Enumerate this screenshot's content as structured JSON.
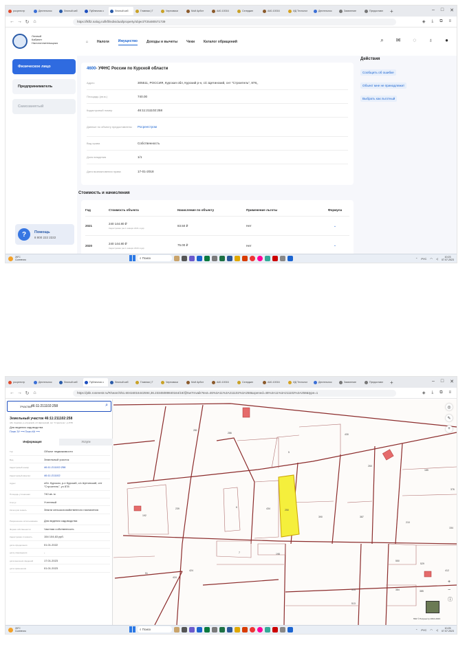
{
  "browser": {
    "tabs": [
      "росреестр",
      "Деятельнос",
      "Личный каб",
      "Публичная к",
      "Личный каб",
      "Главная | Г",
      "Черновики",
      "Мой Арбит",
      "А40-10016",
      "Селедкин",
      "А40-10016",
      "ИД Технолог",
      "Деятельнос",
      "Заявление",
      "Предоставл"
    ],
    "url1": "https://lkfl2.nalog.ru/lkfl/individual/property/object/T25480571739",
    "url2": "https://pkk.rosreestr.ru/#/search/51.60416016442594,36.23345089840164/19/@5w7rnvaik?text=46%3A11%3A211102%3A258&opened=46%3A11%3A211102%3A258&type=1"
  },
  "nalog": {
    "logo_text": [
      "Личный",
      "Кабинет",
      "Налогоплательщика"
    ],
    "sidebar": [
      "Физическое лицо",
      "Предприниматель",
      "Самозанятый"
    ],
    "help_title": "Помощь",
    "help_phone": "8 800 222 2222",
    "nav": [
      "Налоги",
      "Имущество",
      "Доходы и вычеты",
      "Чеки",
      "Каталог обращений"
    ],
    "card_title_code": "4600",
    "card_title": "- УФНС России по Курской области",
    "props": [
      {
        "label": "Адрес",
        "value": "305511, РОССИЯ, Курская обл, Курский р-н, с/с Щетинский, снт \"Строитель\", 878,,",
        "link": false
      },
      {
        "label": "Площадь (кв.м.)",
        "value": "740.00",
        "link": false
      },
      {
        "label": "Кадастровый номер",
        "value": "46:11:211102:258",
        "link": false
      },
      {
        "label": "Данные по объекту предоставлены",
        "value": "Росреестром",
        "link": true
      },
      {
        "label": "Вид права",
        "value": "Собственность",
        "link": false
      },
      {
        "label": "Доля владения",
        "value": "1/1",
        "link": false
      },
      {
        "label": "Дата возникновения права",
        "value": "17-01-2018",
        "link": false
      }
    ],
    "actions_title": "Действия",
    "actions": [
      "Сообщить об ошибке",
      "Объект мне не принадлежит",
      "Выбрать как льготный"
    ],
    "section": "Стоимость и начисления",
    "table_head": [
      "Год",
      "Стоимость объекта",
      "Начисление по объекту",
      "Применение льготы",
      "Формула"
    ],
    "rows": [
      {
        "year": "2021",
        "cost": "240 144.80 ₽",
        "cost_note": "Кадастровая (на 1 января 2021 года)",
        "charge": "83.50 ₽",
        "benefit": "Нет"
      },
      {
        "year": "2020",
        "cost": "240 144.80 ₽",
        "cost_note": "Кадастровая (на 1 января 2020 года)",
        "charge": "75.00 ₽",
        "benefit": "Нет"
      }
    ]
  },
  "rosreestr": {
    "search_label": "Участки",
    "search_value": "46:11:211102:258",
    "title": "Земельный участок 46:11:211102:258",
    "address_small": "обл. Курская, р-н Курский, с/с Щетинский, снт \"Строитель\", уч 878",
    "purpose": "Для ведения садоводства",
    "links": "План ЗУ ⟶     План КК ⟶",
    "tabs": [
      "Информация",
      "Услуги"
    ],
    "rows": [
      {
        "label": "Тип",
        "value": "Объект недвижимости"
      },
      {
        "label": "Вид",
        "value": "Земельный участок"
      },
      {
        "label": "Кадастровый номер",
        "value": "46:11:211102:258",
        "link": true
      },
      {
        "label": "Кадастровый квартал",
        "value": "46:11:211102",
        "link": true
      },
      {
        "label": "Адрес",
        "value": "обл. Курская, р-н Курский, с/с Щетинский, снт \"Строитель\", уч 878"
      },
      {
        "label": "Площадь уточненная",
        "value": "740 кв. м"
      },
      {
        "label": "Статус",
        "value": "Учтенный"
      },
      {
        "label": "Категория земель",
        "value": "Земли сельскохозяйственного назначения"
      },
      {
        "label": "Разрешенное использование",
        "value": "Для ведения садоводства"
      },
      {
        "label": "Форма собственности",
        "value": "Частная собственность"
      },
      {
        "label": "Кадастровая стоимость",
        "value": "154 104,63 руб."
      },
      {
        "label": "дата определения",
        "value": "01.01.2022"
      },
      {
        "label": "дата утверждения",
        "value": "-"
      },
      {
        "label": "дата внесения сведений",
        "value": "17.01.2023"
      },
      {
        "label": "дата применения",
        "value": "01.01.2023"
      }
    ],
    "parcels": [
      "281",
      "286",
      "430",
      "5",
      "260",
      "434",
      "239",
      "6",
      "424",
      "250",
      "390",
      "387",
      "210",
      "7",
      "198",
      "51",
      "424",
      "550",
      "529",
      "384",
      "385",
      "514",
      "513",
      "412",
      "154",
      "192",
      "376",
      "185"
    ],
    "copyright": "ПКК © Росреестр 2010-2023"
  },
  "taskbar": {
    "weather": "26°C",
    "weather_desc": "Солнечно",
    "search": "Поиск",
    "lang": "РУС",
    "time": "10:23",
    "date": "07.07.2023"
  },
  "taskbar2": {
    "time": "10:25",
    "date": "07.07.2023"
  },
  "colors": {
    "accent": "#1b64d0",
    "selected_parcel": "#f5ef3c",
    "boundary": "#8b2b2b"
  }
}
